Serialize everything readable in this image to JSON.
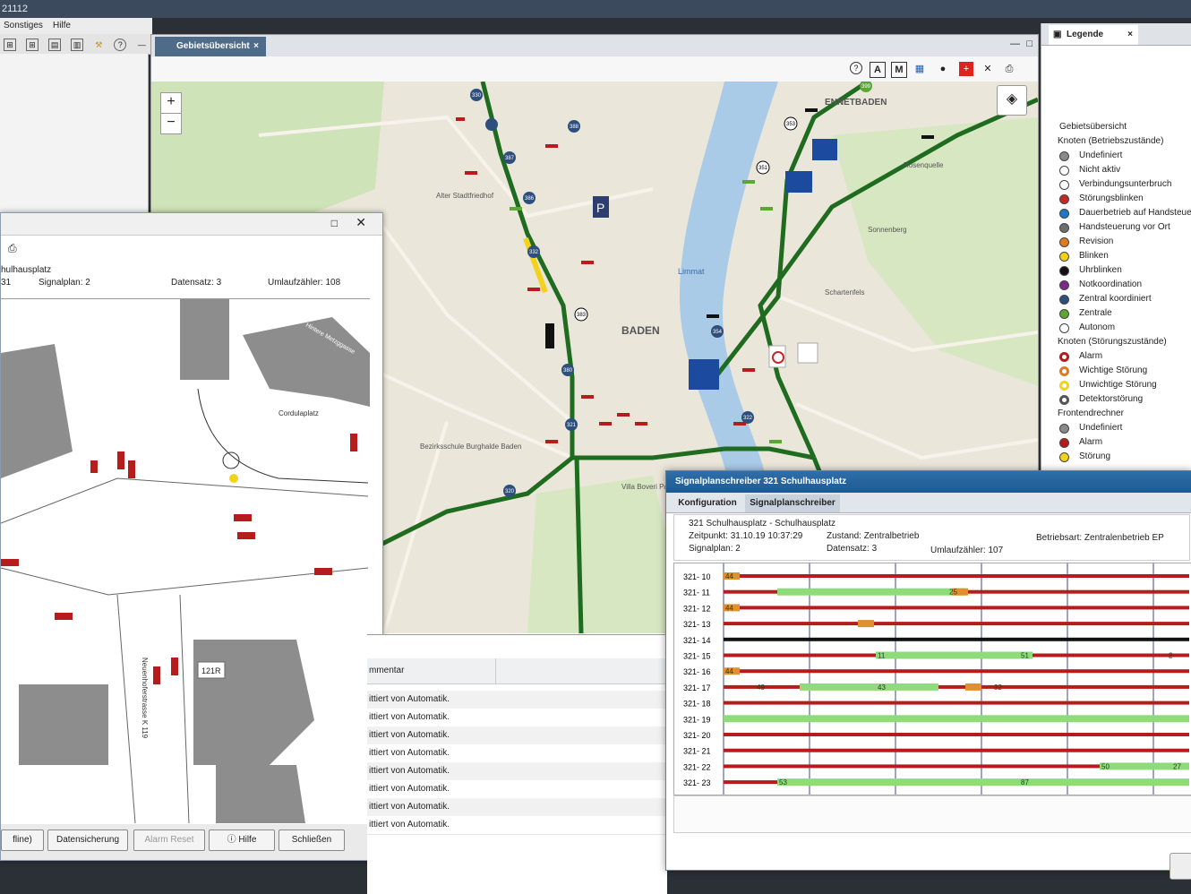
{
  "app": {
    "window_id": "21112"
  },
  "menu": [
    "Sonstiges",
    "Hilfe"
  ],
  "main_tab": {
    "label": "Gebietsübersicht"
  },
  "map": {
    "labels": [
      {
        "text": "BADEN",
        "kind": "city"
      },
      {
        "text": "ENNETBADEN",
        "kind": "district"
      },
      {
        "text": "Bezirksschule Burghalde Baden",
        "kind": "poi"
      },
      {
        "text": "Villa Boveri Park",
        "kind": "poi"
      },
      {
        "text": "Cordulaplatz",
        "kind": "poi"
      },
      {
        "text": "Alter Stadtfriedhof",
        "kind": "poi"
      },
      {
        "text": "Limmat",
        "kind": "river"
      },
      {
        "text": "Sonnenberg",
        "kind": "area"
      },
      {
        "text": "Rosenquelle",
        "kind": "poi"
      },
      {
        "text": "Schartenfels",
        "kind": "area"
      }
    ],
    "nodes": [
      "330",
      "387",
      "386",
      "388",
      "389",
      "399",
      "353",
      "351",
      "383",
      "380",
      "321",
      "320",
      "322",
      "354",
      "332"
    ]
  },
  "legend": {
    "tab": "Legende",
    "section": "Gebietsübersicht",
    "group1": "Knoten (Betriebszustände)",
    "group1_items": [
      {
        "label": "Undefiniert",
        "color": "#8a8a8a"
      },
      {
        "label": "Nicht aktiv",
        "color": "#ffffff"
      },
      {
        "label": "Verbindungsunterbruch",
        "color": "#ffffff"
      },
      {
        "label": "Störungsblinken",
        "color": "#c62828"
      },
      {
        "label": "Dauerbetrieb auf Handsteuerung",
        "color": "#1e78c8"
      },
      {
        "label": "Handsteuerung vor Ort",
        "color": "#6d6d6d"
      },
      {
        "label": "Revision",
        "color": "#e07a1f"
      },
      {
        "label": "Blinken",
        "color": "#f2d21b"
      },
      {
        "label": "Uhrblinken",
        "color": "#111111"
      },
      {
        "label": "Notkoordination",
        "color": "#7b2a8a"
      },
      {
        "label": "Zentral koordiniert",
        "color": "#2e4e7e"
      },
      {
        "label": "Zentrale",
        "color": "#5aa832"
      },
      {
        "label": "Autonom",
        "color": "#ffffff"
      }
    ],
    "group2": "Knoten (Störungszustände)",
    "group2_items": [
      {
        "label": "Alarm",
        "color": "#b71c1c"
      },
      {
        "label": "Wichtige Störung",
        "color": "#e07a1f"
      },
      {
        "label": "Unwichtige Störung",
        "color": "#f2d21b"
      },
      {
        "label": "Detektorstörung",
        "color": "#555555"
      }
    ],
    "group3": "Frontendrechner",
    "group3_items": [
      {
        "label": "Undefiniert",
        "color": "#8a8a8a"
      },
      {
        "label": "Alarm",
        "color": "#b71c1c"
      },
      {
        "label": "Störung",
        "color": "#f2d21b"
      }
    ]
  },
  "sigwin": {
    "name": "hulhausplatz",
    "num": "31",
    "signalplan": "Signalplan: 2",
    "datensatz": "Datensatz: 3",
    "umlauf": "Umlaufzähler: 108",
    "labels": {
      "cordulaplatz": "Cordulaplatz",
      "metzgasse": "Hintere Metzggasse",
      "street": "Neuenhoferstrasse K 119",
      "box": "121R"
    },
    "buttons": [
      "fline)",
      "Datensicherung",
      "Alarm Reset",
      "Hilfe",
      "Schließen"
    ]
  },
  "bottom_list": {
    "header": "mmentar",
    "rows": [
      "ittiert von Automatik.",
      "ittiert von Automatik.",
      "ittiert von Automatik.",
      "ittiert von Automatik.",
      "ittiert von Automatik.",
      "ittiert von Automatik.",
      "ittiert von Automatik.",
      "ittiert von Automatik."
    ]
  },
  "sps": {
    "title": "Signalplanschreiber 321 Schulhausplatz",
    "tabs": [
      "Konfiguration",
      "Signalplanschreiber"
    ],
    "info": {
      "name": "321 Schulhausplatz - Schulhausplatz",
      "zeitpunkt": "Zeitpunkt: 31.10.19 10:37:29",
      "zustand": "Zustand: Zentralbetrieb",
      "betriebsart": "Betriebsart: Zentralenbetrieb EP",
      "signalplan": "Signalplan: 2",
      "datensatz": "Datensatz: 3",
      "umlauf": "Umlaufzähler: 107"
    },
    "rows": [
      "321- 10",
      "321- 11",
      "321- 12",
      "321- 13",
      "321- 14",
      "321- 15",
      "321- 16",
      "321- 17",
      "321- 18",
      "321- 19",
      "321- 20",
      "321- 21",
      "321- 22",
      "321- 23"
    ],
    "numbers": [
      {
        "row": 0,
        "text": "44"
      },
      {
        "row": 1,
        "text": "25"
      },
      {
        "row": 2,
        "text": "44"
      },
      {
        "row": 5,
        "text": "11"
      },
      {
        "row": 5,
        "text": "51"
      },
      {
        "row": 5,
        "text": "2"
      },
      {
        "row": 6,
        "text": "44"
      },
      {
        "row": 7,
        "text": "49"
      },
      {
        "row": 7,
        "text": "43"
      },
      {
        "row": 7,
        "text": "32"
      },
      {
        "row": 12,
        "text": "50"
      },
      {
        "row": 12,
        "text": "27"
      },
      {
        "row": 13,
        "text": "53"
      },
      {
        "row": 13,
        "text": "87"
      }
    ]
  }
}
